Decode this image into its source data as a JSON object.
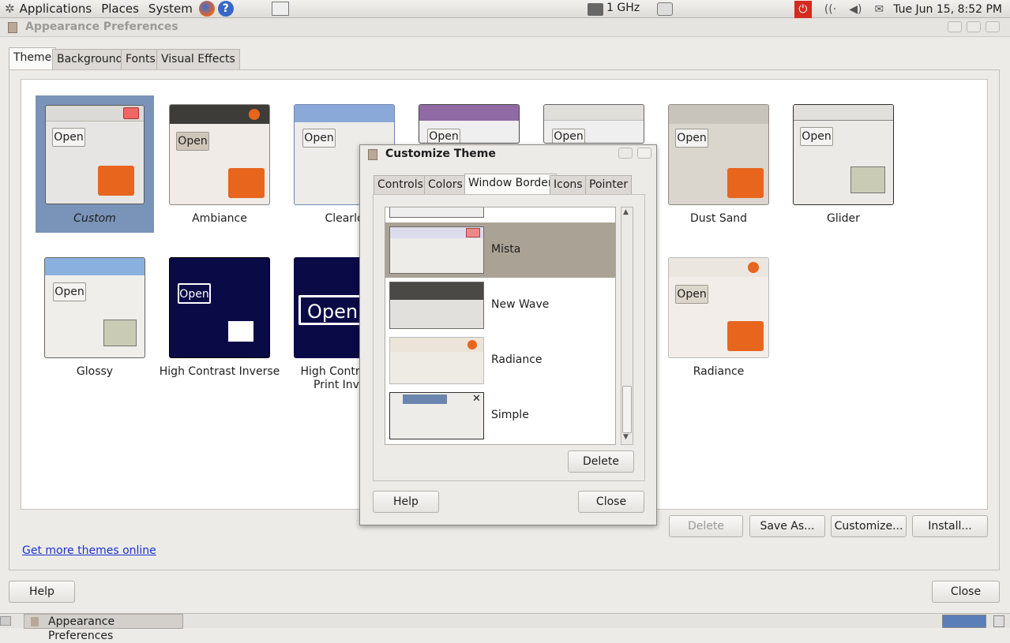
{
  "panel": {
    "menus": [
      "Applications",
      "Places",
      "System"
    ],
    "cpu": "1 GHz",
    "clock": "Tue Jun 15,  8:52 PM"
  },
  "window": {
    "title": "Appearance Preferences",
    "tabs": [
      "Theme",
      "Background",
      "Fonts",
      "Visual Effects"
    ],
    "active_tab": "Theme",
    "themes": [
      {
        "name": "Custom",
        "button": "Open"
      },
      {
        "name": "Ambiance",
        "button": "Open"
      },
      {
        "name": "Clearlo",
        "button": "Open"
      },
      {
        "name": "",
        "button": "Open"
      },
      {
        "name": "",
        "button": "Open"
      },
      {
        "name": "Dust Sand",
        "button": "Open"
      },
      {
        "name": "Glider",
        "button": "Open"
      },
      {
        "name": "Glossy",
        "button": "Open"
      },
      {
        "name": "High Contrast Inverse",
        "button": "Open"
      },
      {
        "name": "High Contras Print Inv",
        "button": "Open"
      },
      {
        "name": "Radiance",
        "button": "Open"
      }
    ],
    "buttons": {
      "delete": "Delete",
      "save_as": "Save As...",
      "customize": "Customize...",
      "install": "Install..."
    },
    "link": "Get more themes online",
    "help": "Help",
    "close": "Close"
  },
  "dialog": {
    "title": "Customize Theme",
    "tabs": [
      "Controls",
      "Colors",
      "Window Border",
      "Icons",
      "Pointer"
    ],
    "active_tab": "Window Border",
    "items": [
      "Mista",
      "New Wave",
      "Radiance",
      "Simple"
    ],
    "selected": "Mista",
    "delete": "Delete",
    "help": "Help",
    "close": "Close"
  },
  "taskbar": {
    "item": "Appearance Preferences"
  },
  "colors": {
    "selection": "#7a93b8",
    "orange": "#e8651e",
    "navy": "#0a0a46"
  }
}
